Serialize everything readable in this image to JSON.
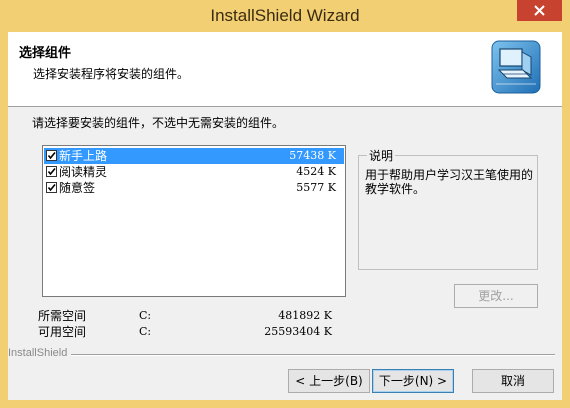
{
  "window": {
    "title": "InstallShield Wizard"
  },
  "header": {
    "title": "选择组件",
    "subtitle": "选择安装程序将安装的组件。",
    "icon": "installer-computer-icon"
  },
  "instruction": "请选择要安装的组件，不选中无需安装的组件。",
  "components": [
    {
      "name": "新手上路",
      "size": "57438 K",
      "checked": true,
      "selected": true
    },
    {
      "name": "阅读精灵",
      "size": "4524 K",
      "checked": true,
      "selected": false
    },
    {
      "name": "随意签",
      "size": "5577 K",
      "checked": true,
      "selected": false
    }
  ],
  "description": {
    "title": "说明",
    "text": "用于帮助用户学习汉王笔使用的教学软件。"
  },
  "change_button": "更改...",
  "space": {
    "required_label": "所需空间",
    "required_drive": "C:",
    "required_value": "481892 K",
    "available_label": "可用空间",
    "available_drive": "C:",
    "available_value": "25593404 K"
  },
  "footer": {
    "brand": "InstallShield",
    "back_button": "< 上一步(B)",
    "next_button": "下一步(N) >",
    "cancel_button": "取消"
  },
  "colors": {
    "title_bar": "#f3cf73",
    "close_button": "#c7432f",
    "selection": "#3399ff"
  }
}
